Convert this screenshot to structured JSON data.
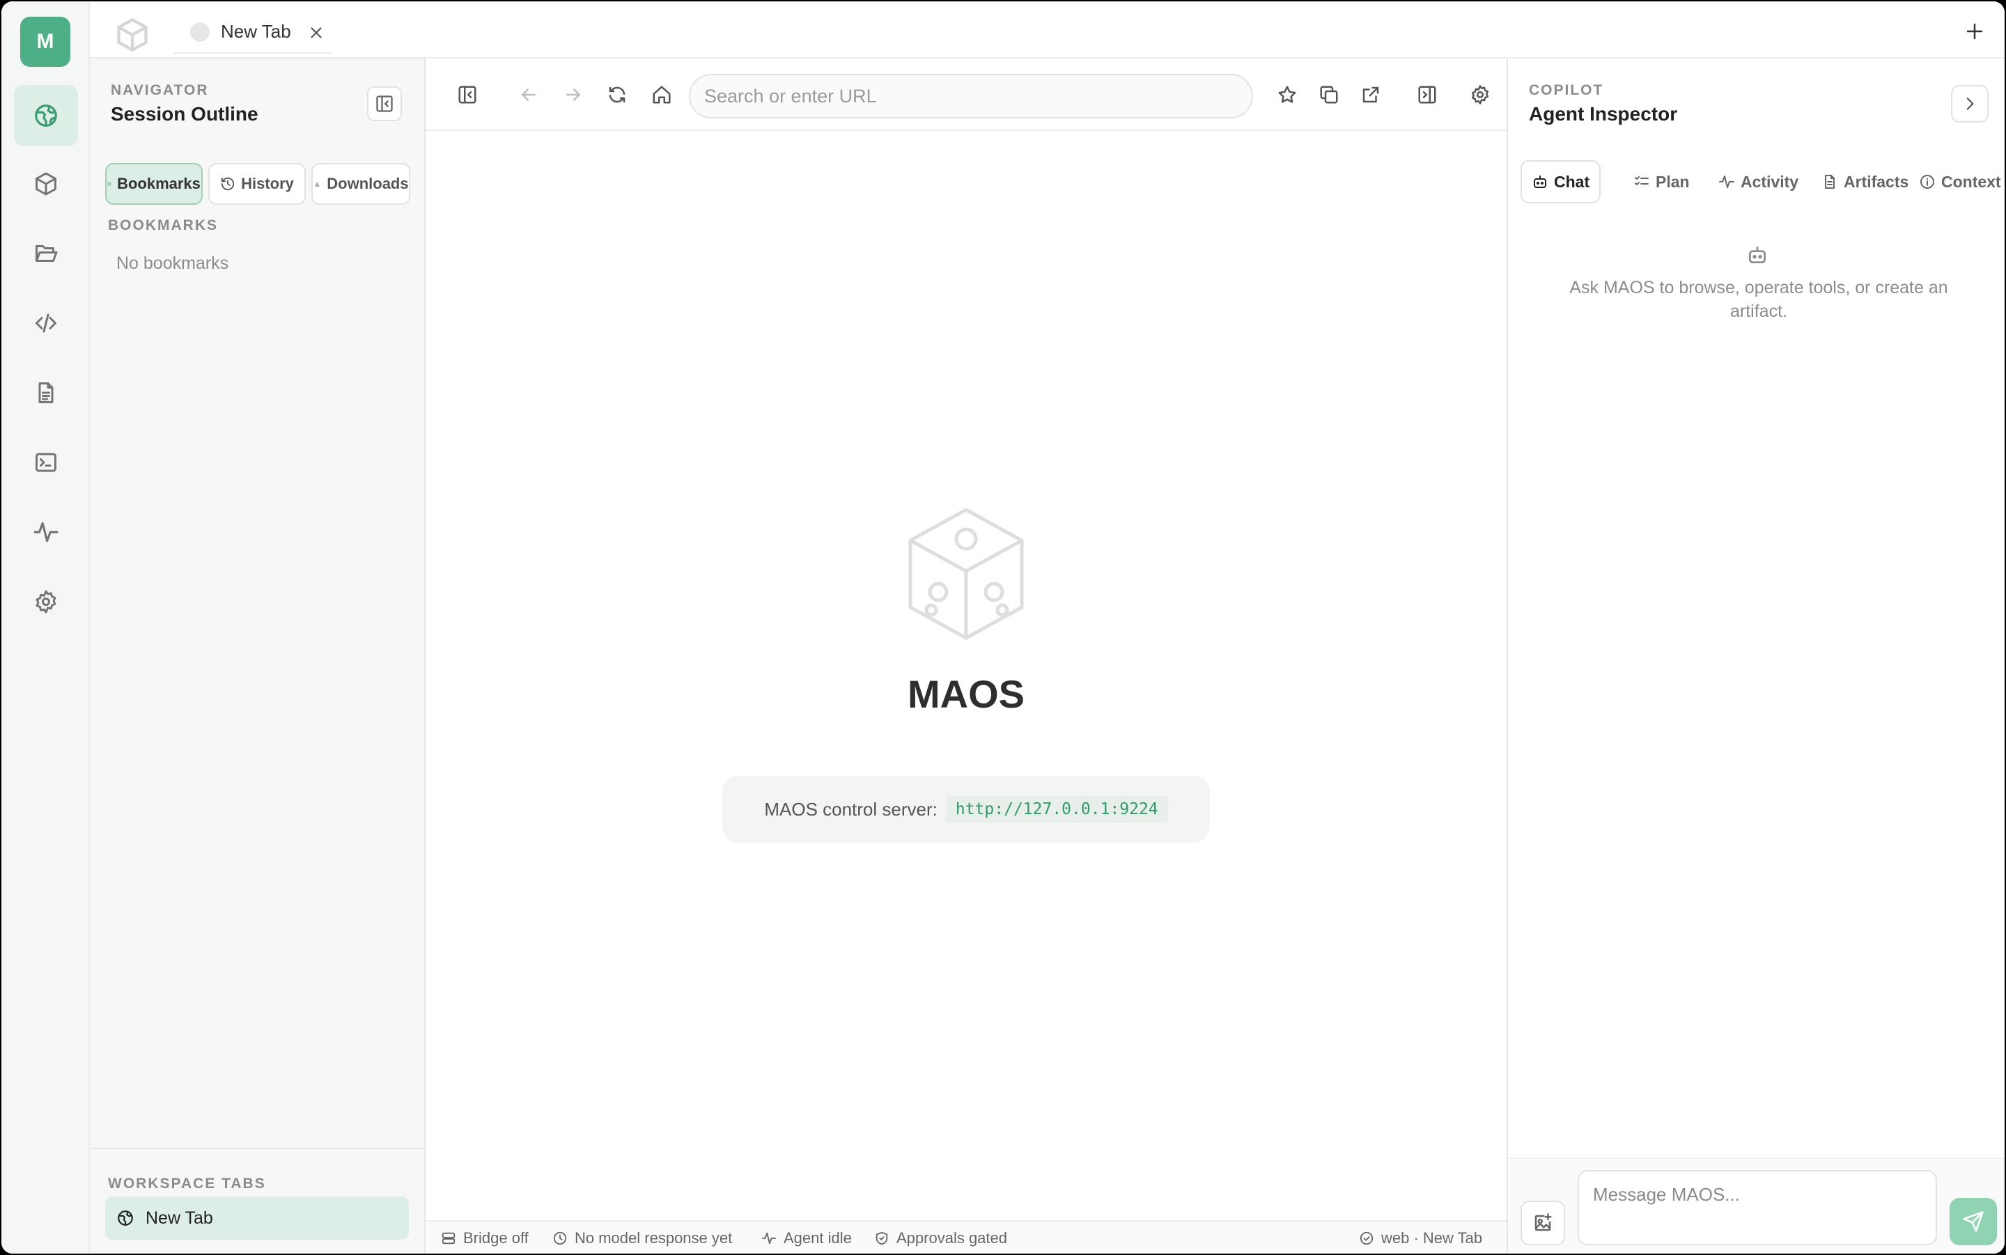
{
  "rail": {
    "avatar_letter": "M",
    "items": [
      {
        "name": "browser-icon",
        "active": true
      },
      {
        "name": "cube-icon"
      },
      {
        "name": "folder-icon"
      },
      {
        "name": "code-icon"
      },
      {
        "name": "document-icon"
      },
      {
        "name": "terminal-icon"
      },
      {
        "name": "activity-icon"
      },
      {
        "name": "gear-icon"
      }
    ]
  },
  "tabs": {
    "items": [
      {
        "label": "New Tab"
      }
    ]
  },
  "navigator": {
    "eyebrow": "NAVIGATOR",
    "title": "Session Outline",
    "segments": [
      {
        "label": "Bookmarks",
        "icon": "bookmark-icon",
        "active": true
      },
      {
        "label": "History",
        "icon": "history-icon"
      },
      {
        "label": "Downloads",
        "icon": "download-icon"
      }
    ],
    "section_label": "BOOKMARKS",
    "empty": "No bookmarks",
    "workspace_label": "WORKSPACE TABS",
    "workspace_tabs": [
      {
        "label": "New Tab"
      }
    ]
  },
  "browser": {
    "url_placeholder": "Search or enter URL",
    "url_value": "",
    "brand": "MAOS",
    "server_label": "MAOS control server:",
    "server_url": "http://127.0.0.1:9224"
  },
  "status": {
    "bridge": "Bridge off",
    "model": "No model response yet",
    "agent": "Agent idle",
    "approvals": "Approvals gated",
    "context": "web · New Tab"
  },
  "copilot": {
    "eyebrow": "COPILOT",
    "title": "Agent Inspector",
    "tabs": [
      {
        "label": "Chat",
        "icon": "robot-icon",
        "active": true
      },
      {
        "label": "Plan",
        "icon": "checklist-icon"
      },
      {
        "label": "Activity",
        "icon": "activity-icon"
      },
      {
        "label": "Artifacts",
        "icon": "document-icon"
      },
      {
        "label": "Context",
        "icon": "info-icon"
      }
    ],
    "hint": "Ask MAOS to browse, operate tools, or create an artifact.",
    "message_placeholder": "Message MAOS..."
  },
  "colors": {
    "accent": "#4caf85",
    "accent_soft": "#dceee5",
    "send": "#8fd3b2"
  }
}
